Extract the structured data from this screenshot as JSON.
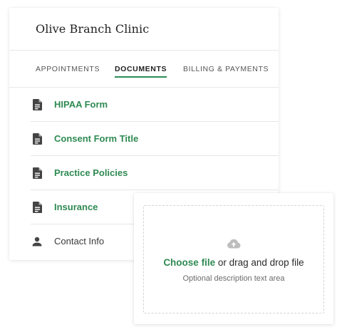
{
  "card": {
    "title": "Olive Branch Clinic"
  },
  "tabs": [
    {
      "label": "APPOINTMENTS",
      "active": false
    },
    {
      "label": "DOCUMENTS",
      "active": true
    },
    {
      "label": "BILLING & PAYMENTS",
      "active": false
    }
  ],
  "documents": [
    {
      "label": "HIPAA Form",
      "icon": "document-icon"
    },
    {
      "label": "Consent Form Title",
      "icon": "document-icon"
    },
    {
      "label": "Practice Policies",
      "icon": "document-icon"
    },
    {
      "label": "Insurance",
      "icon": "document-icon"
    },
    {
      "label": "Contact Info",
      "icon": "person-icon"
    }
  ],
  "upload": {
    "icon": "cloud-upload-icon",
    "choose_label": "Choose file",
    "drag_label": " or drag and drop file",
    "hint": "Optional description text area"
  },
  "colors": {
    "accent": "#2f8a52",
    "icon": "#444444",
    "muted_icon": "#bdbdbd"
  }
}
